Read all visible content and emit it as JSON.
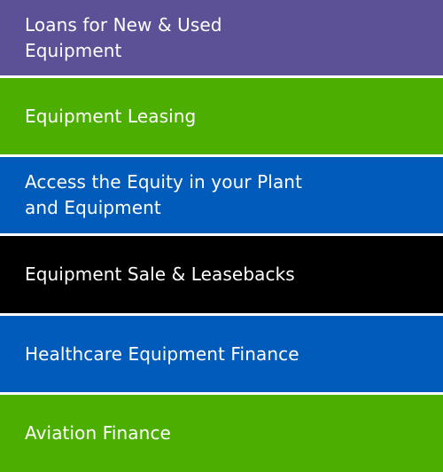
{
  "menu": {
    "items": [
      {
        "label": "Loans for New & Used Equipment",
        "color": "#5c5197"
      },
      {
        "label": "Equipment Leasing",
        "color": "#4caf00"
      },
      {
        "label": "Access the Equity in your Plant and Equipment",
        "color": "#005bbb"
      },
      {
        "label": "Equipment Sale & Leasebacks",
        "color": "#000000"
      },
      {
        "label": "Healthcare Equipment Finance",
        "color": "#005bbb"
      },
      {
        "label": "Aviation Finance",
        "color": "#4caf00"
      }
    ]
  }
}
